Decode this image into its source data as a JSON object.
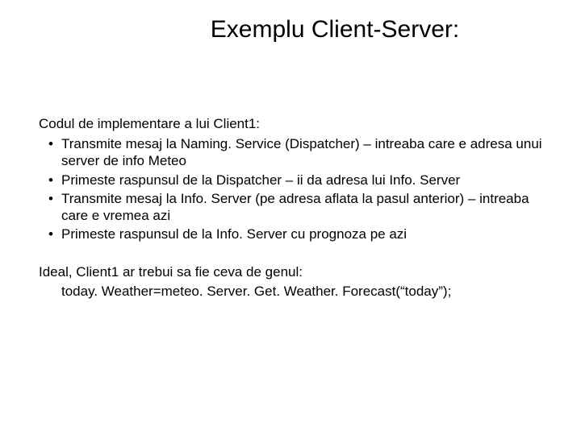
{
  "title": "Exemplu Client-Server:",
  "intro": "Codul de implementare a lui Client1:",
  "bullets": [
    "Transmite mesaj la Naming. Service (Dispatcher) – intreaba care e adresa unui server de info Meteo",
    "Primeste raspunsul de la Dispatcher – ii da adresa lui Info. Server",
    "Transmite mesaj la Info. Server (pe adresa aflata la pasul anterior) – intreaba care e vremea azi",
    "Primeste raspunsul de la Info. Server cu prognoza pe azi"
  ],
  "ideal_intro": "Ideal, Client1 ar trebui sa fie ceva de genul:",
  "ideal_code": "today. Weather=meteo. Server. Get. Weather. Forecast(“today”);"
}
